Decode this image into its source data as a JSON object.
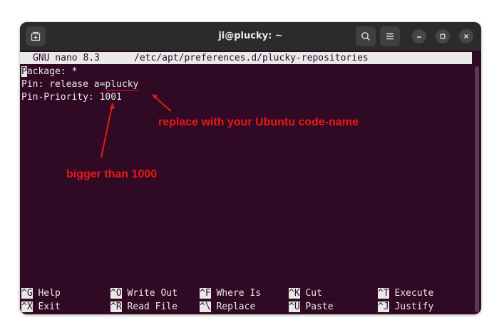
{
  "window": {
    "title": "ji@plucky: ~"
  },
  "nano": {
    "version": "GNU nano 8.3",
    "filename": "/etc/apt/preferences.d/plucky-repositories"
  },
  "editor": {
    "lines": [
      {
        "cursor_char": "P",
        "rest": "ackage: *"
      },
      {
        "prefix": "Pin: release a=",
        "highlight": "plucky"
      },
      {
        "text": "Pin-Priority: 1001"
      }
    ]
  },
  "shortcuts": [
    {
      "key": "^G",
      "label": "Help"
    },
    {
      "key": "^O",
      "label": "Write Out"
    },
    {
      "key": "^F",
      "label": "Where Is"
    },
    {
      "key": "^K",
      "label": "Cut"
    },
    {
      "key": "^T",
      "label": "Execute"
    },
    {
      "key": "^X",
      "label": "Exit"
    },
    {
      "key": "^R",
      "label": "Read File"
    },
    {
      "key": "^\\",
      "label": "Replace"
    },
    {
      "key": "^U",
      "label": "Paste"
    },
    {
      "key": "^J",
      "label": "Justify"
    }
  ],
  "annotations": {
    "codename": "replace with your Ubuntu code-name",
    "priority": "bigger than 1000"
  },
  "colors": {
    "terminal_bg": "#300a24",
    "titlebar_bg": "#2b2b2b",
    "text": "#e9e9e9",
    "annotation": "#e81818"
  },
  "icons": {
    "new_tab": "new-tab-icon",
    "search": "search-icon",
    "menu": "hamburger-menu-icon",
    "minimize": "minimize-icon",
    "maximize": "maximize-icon",
    "close": "close-icon"
  }
}
